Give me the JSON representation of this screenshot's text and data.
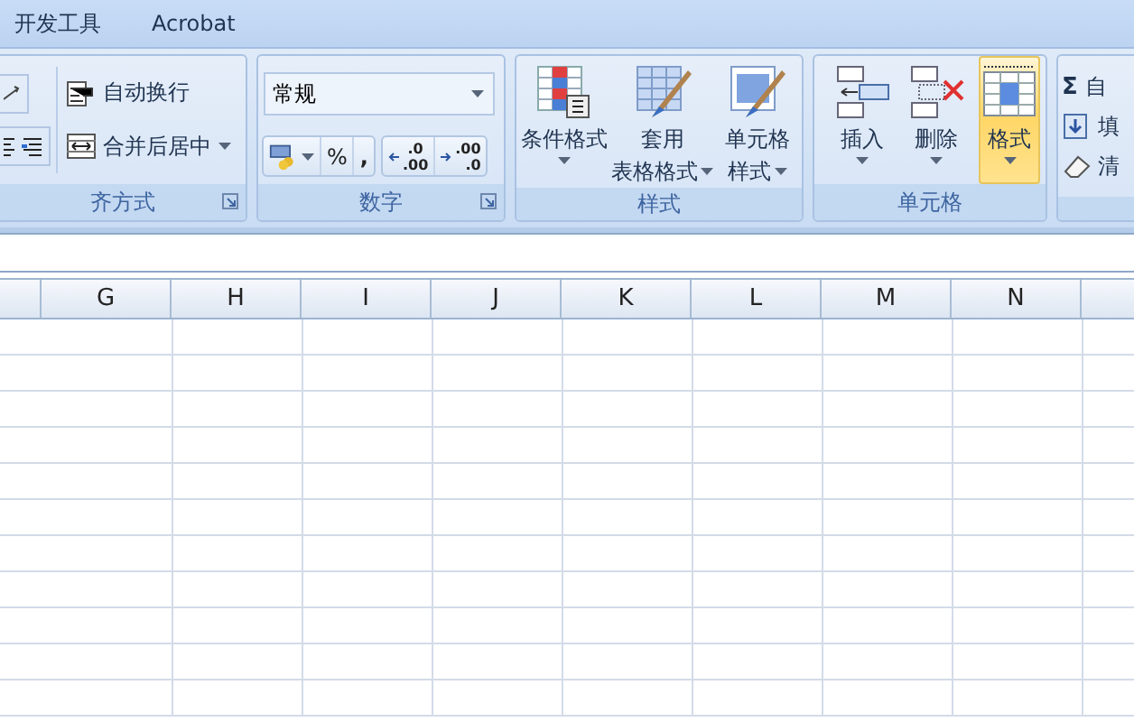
{
  "tabs": [
    {
      "label": "开发工具"
    },
    {
      "label": "Acrobat"
    }
  ],
  "alignment_group": {
    "label": "齐方式",
    "buttons": [
      {
        "kind": "wrap",
        "label": "自动换行",
        "dropdown": false
      },
      {
        "kind": "merge",
        "label": "合并后居中",
        "dropdown": true
      }
    ]
  },
  "number_group": {
    "label": "数字",
    "format": "常规",
    "percent": "%",
    "comma": ",",
    "increase_decimal": [
      ".0",
      ".00"
    ],
    "decrease_decimal": [
      ".00",
      ".0"
    ]
  },
  "styles_group": {
    "label": "样式",
    "buttons": [
      {
        "kind": "conditional",
        "lines": [
          "条件格式"
        ]
      },
      {
        "kind": "table",
        "lines": [
          "套用",
          "表格格式"
        ]
      },
      {
        "kind": "cellstyle",
        "lines": [
          "单元格",
          "样式"
        ]
      }
    ]
  },
  "cells_group": {
    "label": "单元格",
    "buttons": [
      {
        "kind": "insert",
        "label": "插入",
        "selected": false
      },
      {
        "kind": "delete",
        "label": "删除",
        "selected": false
      },
      {
        "kind": "format",
        "label": "格式",
        "selected": true
      }
    ]
  },
  "editing_group": {
    "items": [
      {
        "kind": "sum",
        "symbol": "Σ",
        "label": "自"
      },
      {
        "kind": "fill",
        "label": "填"
      },
      {
        "kind": "clear",
        "label": "清"
      }
    ]
  },
  "columns": [
    "G",
    "H",
    "I",
    "J",
    "K",
    "L",
    "M",
    "N"
  ]
}
